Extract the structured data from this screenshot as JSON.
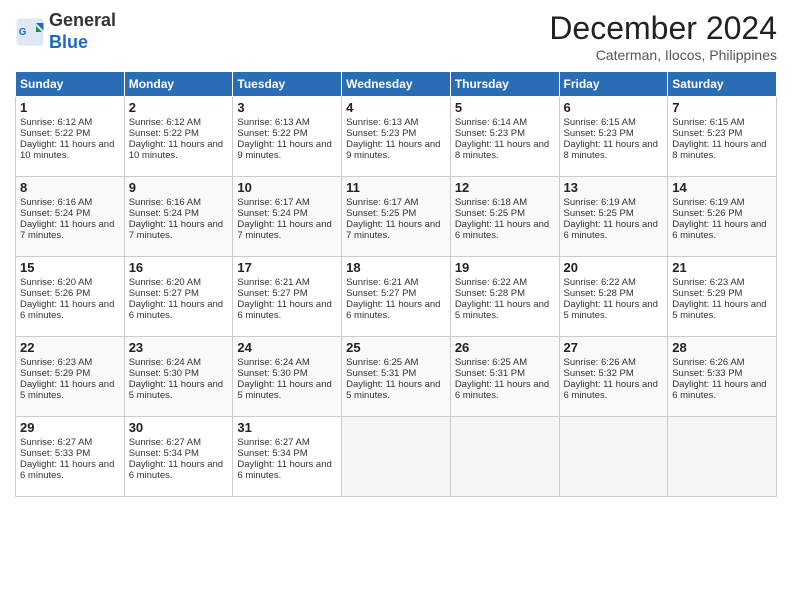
{
  "logo": {
    "line1": "General",
    "line2": "Blue"
  },
  "title": "December 2024",
  "location": "Caterman, Ilocos, Philippines",
  "days_of_week": [
    "Sunday",
    "Monday",
    "Tuesday",
    "Wednesday",
    "Thursday",
    "Friday",
    "Saturday"
  ],
  "weeks": [
    [
      {
        "day": 1,
        "sunrise": "6:12 AM",
        "sunset": "5:22 PM",
        "daylight": "11 hours and 10 minutes."
      },
      {
        "day": 2,
        "sunrise": "6:12 AM",
        "sunset": "5:22 PM",
        "daylight": "11 hours and 10 minutes."
      },
      {
        "day": 3,
        "sunrise": "6:13 AM",
        "sunset": "5:22 PM",
        "daylight": "11 hours and 9 minutes."
      },
      {
        "day": 4,
        "sunrise": "6:13 AM",
        "sunset": "5:23 PM",
        "daylight": "11 hours and 9 minutes."
      },
      {
        "day": 5,
        "sunrise": "6:14 AM",
        "sunset": "5:23 PM",
        "daylight": "11 hours and 8 minutes."
      },
      {
        "day": 6,
        "sunrise": "6:15 AM",
        "sunset": "5:23 PM",
        "daylight": "11 hours and 8 minutes."
      },
      {
        "day": 7,
        "sunrise": "6:15 AM",
        "sunset": "5:23 PM",
        "daylight": "11 hours and 8 minutes."
      }
    ],
    [
      {
        "day": 8,
        "sunrise": "6:16 AM",
        "sunset": "5:24 PM",
        "daylight": "11 hours and 7 minutes."
      },
      {
        "day": 9,
        "sunrise": "6:16 AM",
        "sunset": "5:24 PM",
        "daylight": "11 hours and 7 minutes."
      },
      {
        "day": 10,
        "sunrise": "6:17 AM",
        "sunset": "5:24 PM",
        "daylight": "11 hours and 7 minutes."
      },
      {
        "day": 11,
        "sunrise": "6:17 AM",
        "sunset": "5:25 PM",
        "daylight": "11 hours and 7 minutes."
      },
      {
        "day": 12,
        "sunrise": "6:18 AM",
        "sunset": "5:25 PM",
        "daylight": "11 hours and 6 minutes."
      },
      {
        "day": 13,
        "sunrise": "6:19 AM",
        "sunset": "5:25 PM",
        "daylight": "11 hours and 6 minutes."
      },
      {
        "day": 14,
        "sunrise": "6:19 AM",
        "sunset": "5:26 PM",
        "daylight": "11 hours and 6 minutes."
      }
    ],
    [
      {
        "day": 15,
        "sunrise": "6:20 AM",
        "sunset": "5:26 PM",
        "daylight": "11 hours and 6 minutes."
      },
      {
        "day": 16,
        "sunrise": "6:20 AM",
        "sunset": "5:27 PM",
        "daylight": "11 hours and 6 minutes."
      },
      {
        "day": 17,
        "sunrise": "6:21 AM",
        "sunset": "5:27 PM",
        "daylight": "11 hours and 6 minutes."
      },
      {
        "day": 18,
        "sunrise": "6:21 AM",
        "sunset": "5:27 PM",
        "daylight": "11 hours and 6 minutes."
      },
      {
        "day": 19,
        "sunrise": "6:22 AM",
        "sunset": "5:28 PM",
        "daylight": "11 hours and 5 minutes."
      },
      {
        "day": 20,
        "sunrise": "6:22 AM",
        "sunset": "5:28 PM",
        "daylight": "11 hours and 5 minutes."
      },
      {
        "day": 21,
        "sunrise": "6:23 AM",
        "sunset": "5:29 PM",
        "daylight": "11 hours and 5 minutes."
      }
    ],
    [
      {
        "day": 22,
        "sunrise": "6:23 AM",
        "sunset": "5:29 PM",
        "daylight": "11 hours and 5 minutes."
      },
      {
        "day": 23,
        "sunrise": "6:24 AM",
        "sunset": "5:30 PM",
        "daylight": "11 hours and 5 minutes."
      },
      {
        "day": 24,
        "sunrise": "6:24 AM",
        "sunset": "5:30 PM",
        "daylight": "11 hours and 5 minutes."
      },
      {
        "day": 25,
        "sunrise": "6:25 AM",
        "sunset": "5:31 PM",
        "daylight": "11 hours and 5 minutes."
      },
      {
        "day": 26,
        "sunrise": "6:25 AM",
        "sunset": "5:31 PM",
        "daylight": "11 hours and 6 minutes."
      },
      {
        "day": 27,
        "sunrise": "6:26 AM",
        "sunset": "5:32 PM",
        "daylight": "11 hours and 6 minutes."
      },
      {
        "day": 28,
        "sunrise": "6:26 AM",
        "sunset": "5:33 PM",
        "daylight": "11 hours and 6 minutes."
      }
    ],
    [
      {
        "day": 29,
        "sunrise": "6:27 AM",
        "sunset": "5:33 PM",
        "daylight": "11 hours and 6 minutes."
      },
      {
        "day": 30,
        "sunrise": "6:27 AM",
        "sunset": "5:34 PM",
        "daylight": "11 hours and 6 minutes."
      },
      {
        "day": 31,
        "sunrise": "6:27 AM",
        "sunset": "5:34 PM",
        "daylight": "11 hours and 6 minutes."
      },
      null,
      null,
      null,
      null
    ]
  ]
}
